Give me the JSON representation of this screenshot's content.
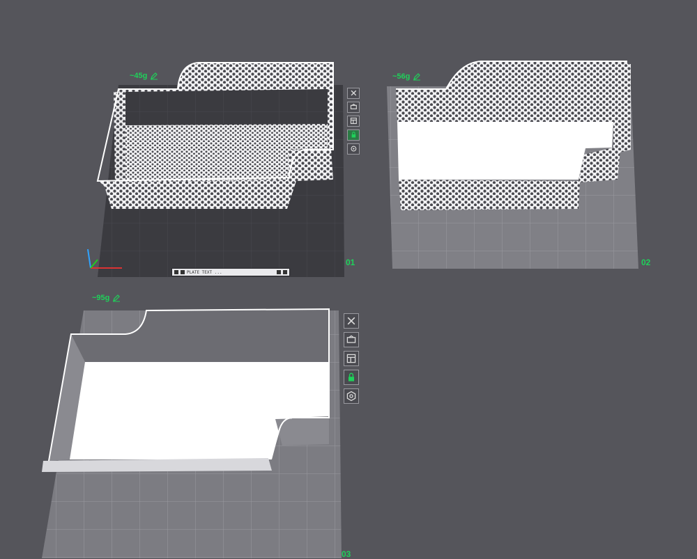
{
  "plates": [
    {
      "number": "01",
      "weight": "~45g",
      "object": "perforated-basket"
    },
    {
      "number": "02",
      "weight": "~56g",
      "object": "perforated-basket-side-view"
    },
    {
      "number": "03",
      "weight": "~95g",
      "object": "solid-tray"
    }
  ],
  "plate_tools": [
    {
      "name": "close-icon"
    },
    {
      "name": "auto-orient-icon"
    },
    {
      "name": "arrange-icon"
    },
    {
      "name": "lock-icon"
    },
    {
      "name": "settings-icon"
    }
  ],
  "mini_bar": {
    "text": "PLATE TEXT ..."
  },
  "colors": {
    "background": "#55555b",
    "accent_green": "#1fd15a",
    "plate_dark": "#3b3b40",
    "plate_light": "#8c8c92",
    "model_white": "#f4f4f6"
  }
}
